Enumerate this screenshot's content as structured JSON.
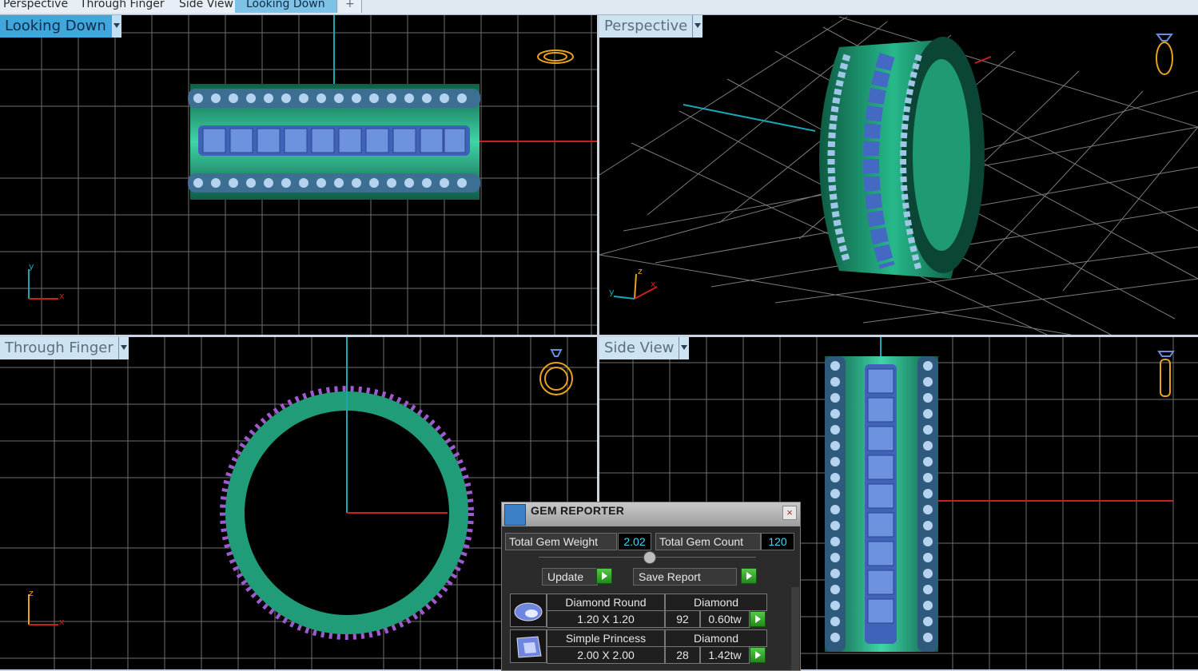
{
  "tabs": [
    {
      "label": "Perspective"
    },
    {
      "label": "Through Finger"
    },
    {
      "label": "Side View"
    },
    {
      "label": "Looking Down"
    },
    {
      "label": "+"
    }
  ],
  "viewports": {
    "looking_down": {
      "label": "Looking Down",
      "axis1": "y",
      "axis2": "x"
    },
    "perspective": {
      "label": "Perspective",
      "axis1": "z",
      "axis2": "x",
      "axis3": "y"
    },
    "through_finger": {
      "label": "Through Finger",
      "axis1": "z",
      "axis2": "x"
    },
    "side_view": {
      "label": "Side View"
    }
  },
  "gem_reporter": {
    "title": "GEM REPORTER",
    "close": "×",
    "total_weight_label": "Total Gem Weight",
    "total_weight_value": "2.02",
    "total_count_label": "Total Gem Count",
    "total_count_value": "120",
    "update_label": "Update",
    "save_report_label": "Save Report",
    "rows": [
      {
        "shape": "Diamond Round",
        "material": "Diamond",
        "size": "1.20 X 1.20",
        "count": "92",
        "weight": "0.60tw"
      },
      {
        "shape": "Simple Princess",
        "material": "Diamond",
        "size": "2.00 X 2.00",
        "count": "28",
        "weight": "1.42tw"
      }
    ]
  },
  "colors": {
    "viewport_bg": "#000000",
    "grid": "#7a7a7a",
    "metal": "#1f9a74",
    "gem_blue": "#4a72c8",
    "accent_blue": "#3fa6de",
    "axis_red": "#c8201e",
    "axis_cyan": "#1aa6b5"
  }
}
